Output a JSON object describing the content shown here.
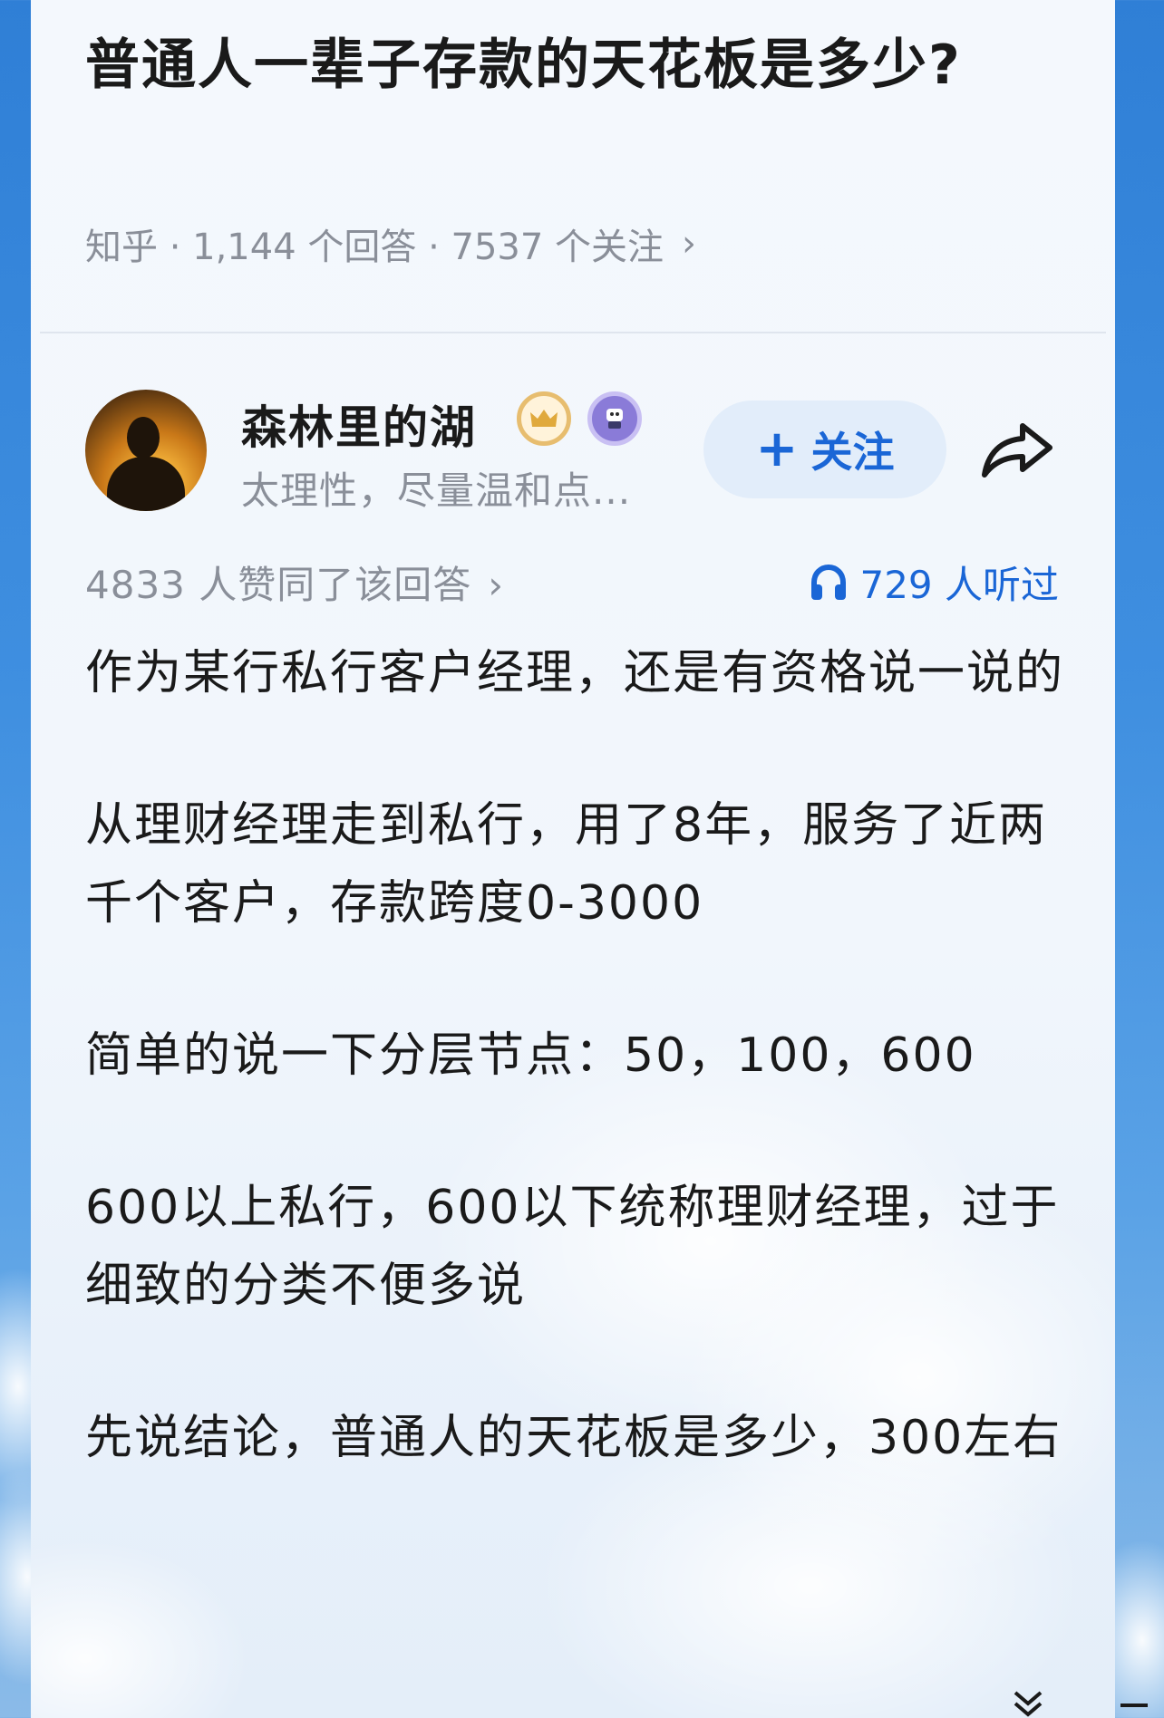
{
  "question": {
    "title": "普通人一辈子存款的天花板是多少?",
    "meta": "知乎 · 1,144 个回答 · 7537 个关注",
    "meta_chevron": "›"
  },
  "author": {
    "name": "森林里的湖",
    "bio": "太理性，尽量温和点...",
    "follow_label": "关注",
    "follow_plus": "+",
    "badges": [
      "crown-badge-icon",
      "figure-badge-icon"
    ]
  },
  "stats": {
    "votes": "4833 人赞同了该回答",
    "votes_chevron": "›",
    "listen": "729 人听过"
  },
  "answer": {
    "paragraphs": [
      "作为某行私行客户经理，还是有资格说一说的",
      "从理财经理走到私行，用了8年，服务了近两千个客户，存款跨度0-3000",
      "简单的说一下分层节点：50，100，600",
      "600以上私行，600以下统称理财经理，过于细致的分类不便多说",
      "先说结论，普通人的天花板是多少，300左右"
    ]
  },
  "colors": {
    "accent": "#1a66d6",
    "follow_bg": "#e2edfa",
    "meta_gray": "#8a8f99",
    "text": "#1a1a1a"
  }
}
